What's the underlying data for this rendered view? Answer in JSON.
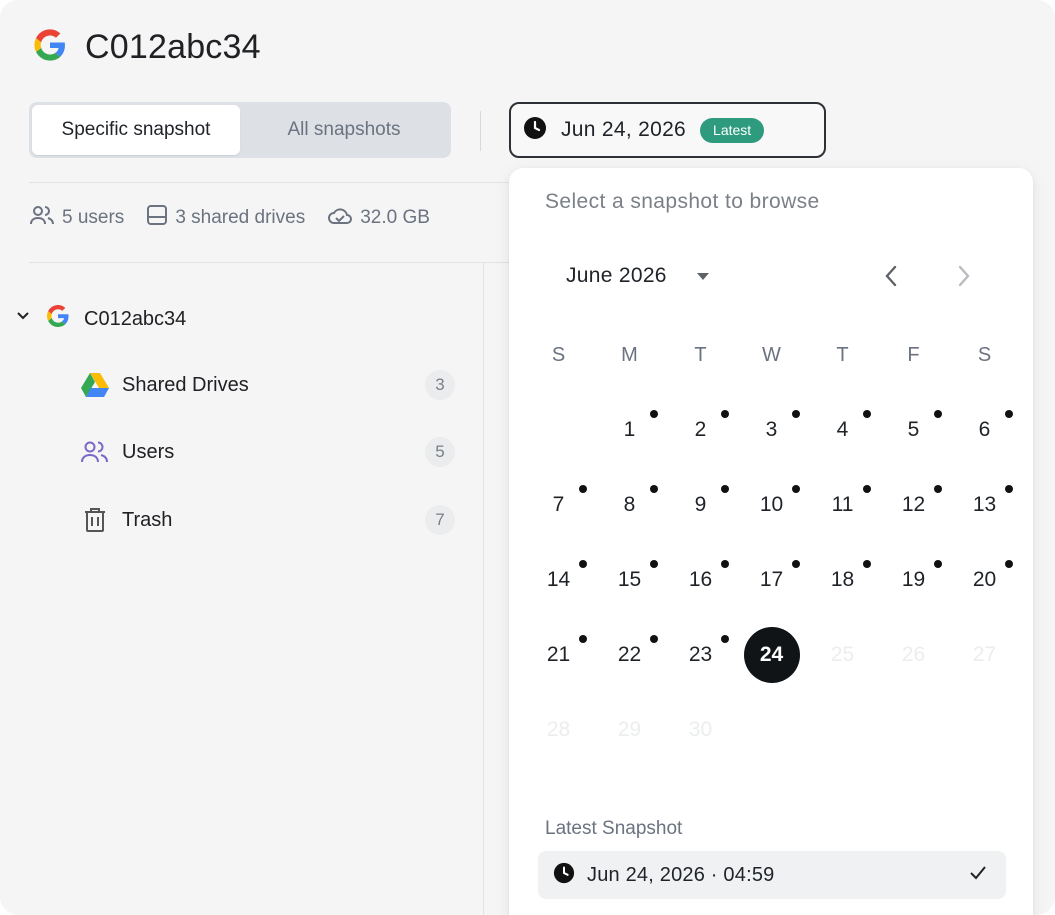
{
  "header": {
    "title": "C012abc34",
    "logo_icon": "google-g-icon"
  },
  "view_tabs": {
    "active_label": "Specific snapshot",
    "inactive_label": "All snapshots"
  },
  "snapshot_button": {
    "date_label": "Jun 24, 2026",
    "badge_label": "Latest",
    "icon": "clock-icon",
    "badge_color": "#2e9b7f"
  },
  "stats": {
    "users": "5 users",
    "shared_drives": "3 shared drives",
    "storage": "32.0 GB"
  },
  "tree": {
    "root_label": "C012abc34",
    "items": [
      {
        "label": "Shared Drives",
        "count": "3",
        "icon": "google-drive-icon"
      },
      {
        "label": "Users",
        "count": "5",
        "icon": "users-icon"
      },
      {
        "label": "Trash",
        "count": "7",
        "icon": "trash-icon"
      }
    ]
  },
  "popover": {
    "title": "Select a snapshot to browse",
    "month_label": "June 2026",
    "weekdays": [
      "S",
      "M",
      "T",
      "W",
      "T",
      "F",
      "S"
    ],
    "weeks": [
      [
        {
          "day": "",
          "dot": false,
          "disabled": false,
          "selected": false
        },
        {
          "day": "1",
          "dot": true,
          "disabled": false,
          "selected": false
        },
        {
          "day": "2",
          "dot": true,
          "disabled": false,
          "selected": false
        },
        {
          "day": "3",
          "dot": true,
          "disabled": false,
          "selected": false
        },
        {
          "day": "4",
          "dot": true,
          "disabled": false,
          "selected": false
        },
        {
          "day": "5",
          "dot": true,
          "disabled": false,
          "selected": false
        },
        {
          "day": "6",
          "dot": true,
          "disabled": false,
          "selected": false
        }
      ],
      [
        {
          "day": "7",
          "dot": true,
          "disabled": false,
          "selected": false
        },
        {
          "day": "8",
          "dot": true,
          "disabled": false,
          "selected": false
        },
        {
          "day": "9",
          "dot": true,
          "disabled": false,
          "selected": false
        },
        {
          "day": "10",
          "dot": true,
          "disabled": false,
          "selected": false
        },
        {
          "day": "11",
          "dot": true,
          "disabled": false,
          "selected": false
        },
        {
          "day": "12",
          "dot": true,
          "disabled": false,
          "selected": false
        },
        {
          "day": "13",
          "dot": true,
          "disabled": false,
          "selected": false
        }
      ],
      [
        {
          "day": "14",
          "dot": true,
          "disabled": false,
          "selected": false
        },
        {
          "day": "15",
          "dot": true,
          "disabled": false,
          "selected": false
        },
        {
          "day": "16",
          "dot": true,
          "disabled": false,
          "selected": false
        },
        {
          "day": "17",
          "dot": true,
          "disabled": false,
          "selected": false
        },
        {
          "day": "18",
          "dot": true,
          "disabled": false,
          "selected": false
        },
        {
          "day": "19",
          "dot": true,
          "disabled": false,
          "selected": false
        },
        {
          "day": "20",
          "dot": true,
          "disabled": false,
          "selected": false
        }
      ],
      [
        {
          "day": "21",
          "dot": true,
          "disabled": false,
          "selected": false
        },
        {
          "day": "22",
          "dot": true,
          "disabled": false,
          "selected": false
        },
        {
          "day": "23",
          "dot": true,
          "disabled": false,
          "selected": false
        },
        {
          "day": "24",
          "dot": false,
          "disabled": false,
          "selected": true
        },
        {
          "day": "25",
          "dot": false,
          "disabled": true,
          "selected": false
        },
        {
          "day": "26",
          "dot": false,
          "disabled": true,
          "selected": false
        },
        {
          "day": "27",
          "dot": false,
          "disabled": true,
          "selected": false
        }
      ],
      [
        {
          "day": "28",
          "dot": false,
          "disabled": true,
          "selected": false
        },
        {
          "day": "29",
          "dot": false,
          "disabled": true,
          "selected": false
        },
        {
          "day": "30",
          "dot": false,
          "disabled": true,
          "selected": false
        },
        {
          "day": "",
          "dot": false,
          "disabled": true,
          "selected": false
        },
        {
          "day": "",
          "dot": false,
          "disabled": true,
          "selected": false
        },
        {
          "day": "",
          "dot": false,
          "disabled": true,
          "selected": false
        },
        {
          "day": "",
          "dot": false,
          "disabled": true,
          "selected": false
        }
      ]
    ],
    "latest_label": "Latest Snapshot",
    "latest_option": "Jun 24, 2026 · 04:59",
    "latest_option_icon": "clock-icon",
    "check_icon": "check-icon"
  }
}
